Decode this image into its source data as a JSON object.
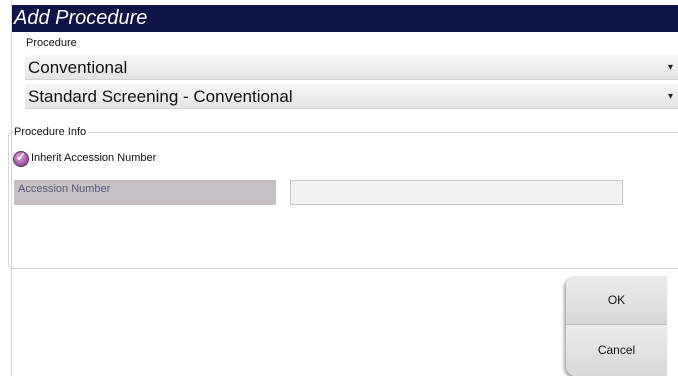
{
  "dialog": {
    "title": "Add Procedure"
  },
  "procedure": {
    "group_label": "Procedure",
    "type_selected": "Conventional",
    "procedure_selected": "Standard Screening - Conventional"
  },
  "procedure_info": {
    "group_label": "Procedure Info",
    "inherit_checkbox_label": "Inherit Accession Number",
    "inherit_checked": true,
    "accession_label": "Accession Number",
    "accession_value": ""
  },
  "buttons": {
    "ok_label": "OK",
    "cancel_label": "Cancel"
  },
  "icons": {
    "dropdown_arrow": "chevron-down-icon",
    "checkbox": "checkmark-icon"
  },
  "colors": {
    "title_bar": "#0f1446",
    "checkbox": "#9a4c9e"
  }
}
